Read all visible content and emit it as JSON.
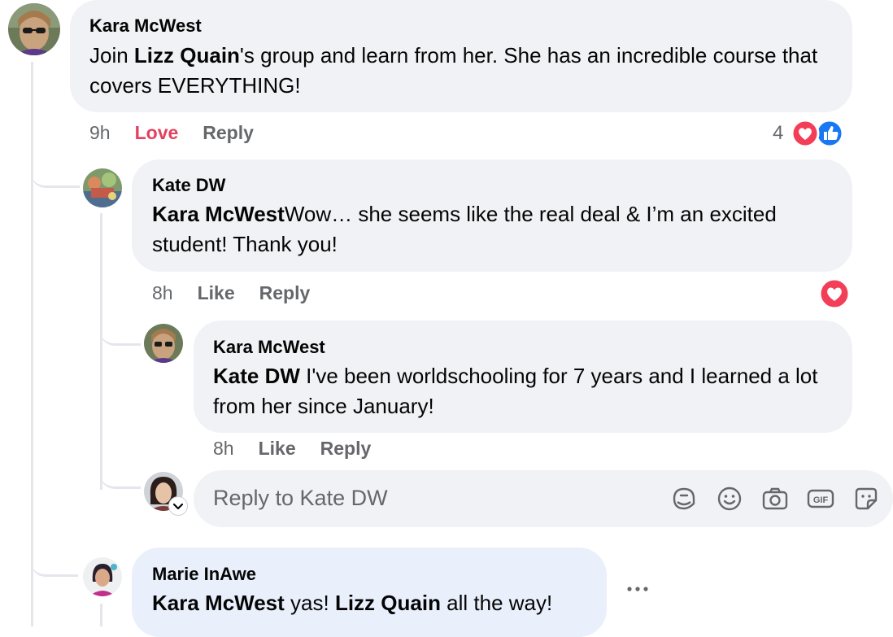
{
  "comments": [
    {
      "author": "Kara McWest",
      "parts": [
        {
          "text": "Join ",
          "bold": false
        },
        {
          "text": "Lizz Quain",
          "bold": true
        },
        {
          "text": "'s group and learn from her. She has an incredible course that covers EVERYTHING!",
          "bold": false
        }
      ],
      "time": "9h",
      "react_label": "Love",
      "reply_label": "Reply",
      "reaction_count": "4",
      "reactions": [
        "heart-icon",
        "like-icon"
      ]
    },
    {
      "author": "Kate DW",
      "parts": [
        {
          "text": "Kara McWest",
          "bold": true
        },
        {
          "text": "Wow… she seems like the real deal & I’m an excited student! Thank you!",
          "bold": false
        }
      ],
      "time": "8h",
      "react_label": "Like",
      "reply_label": "Reply",
      "reactions": [
        "heart-icon"
      ]
    },
    {
      "author": "Kara McWest",
      "parts": [
        {
          "text": "Kate DW",
          "bold": true
        },
        {
          "text": " I've been worldschooling for 7 years and I learned a lot from her since January!",
          "bold": false
        }
      ],
      "time": "8h",
      "react_label": "Like",
      "reply_label": "Reply"
    },
    {
      "author": "Marie InAwe",
      "parts": [
        {
          "text": "Kara McWest",
          "bold": true
        },
        {
          "text": " yas! ",
          "bold": false
        },
        {
          "text": "Lizz Quain",
          "bold": true
        },
        {
          "text": " all the way!",
          "bold": false
        }
      ]
    }
  ],
  "reply_box": {
    "placeholder": "Reply to Kate DW",
    "icons": [
      "sticker-icon",
      "emoji-icon",
      "camera-icon",
      "gif-icon",
      "avatar-sticker-icon"
    ]
  },
  "colors": {
    "bubble": "#f0f2f5",
    "bubble_highlight": "#e9f0fc",
    "love": "#e4405f",
    "like_blue": "#1877f2",
    "secondary_text": "#65676b"
  }
}
